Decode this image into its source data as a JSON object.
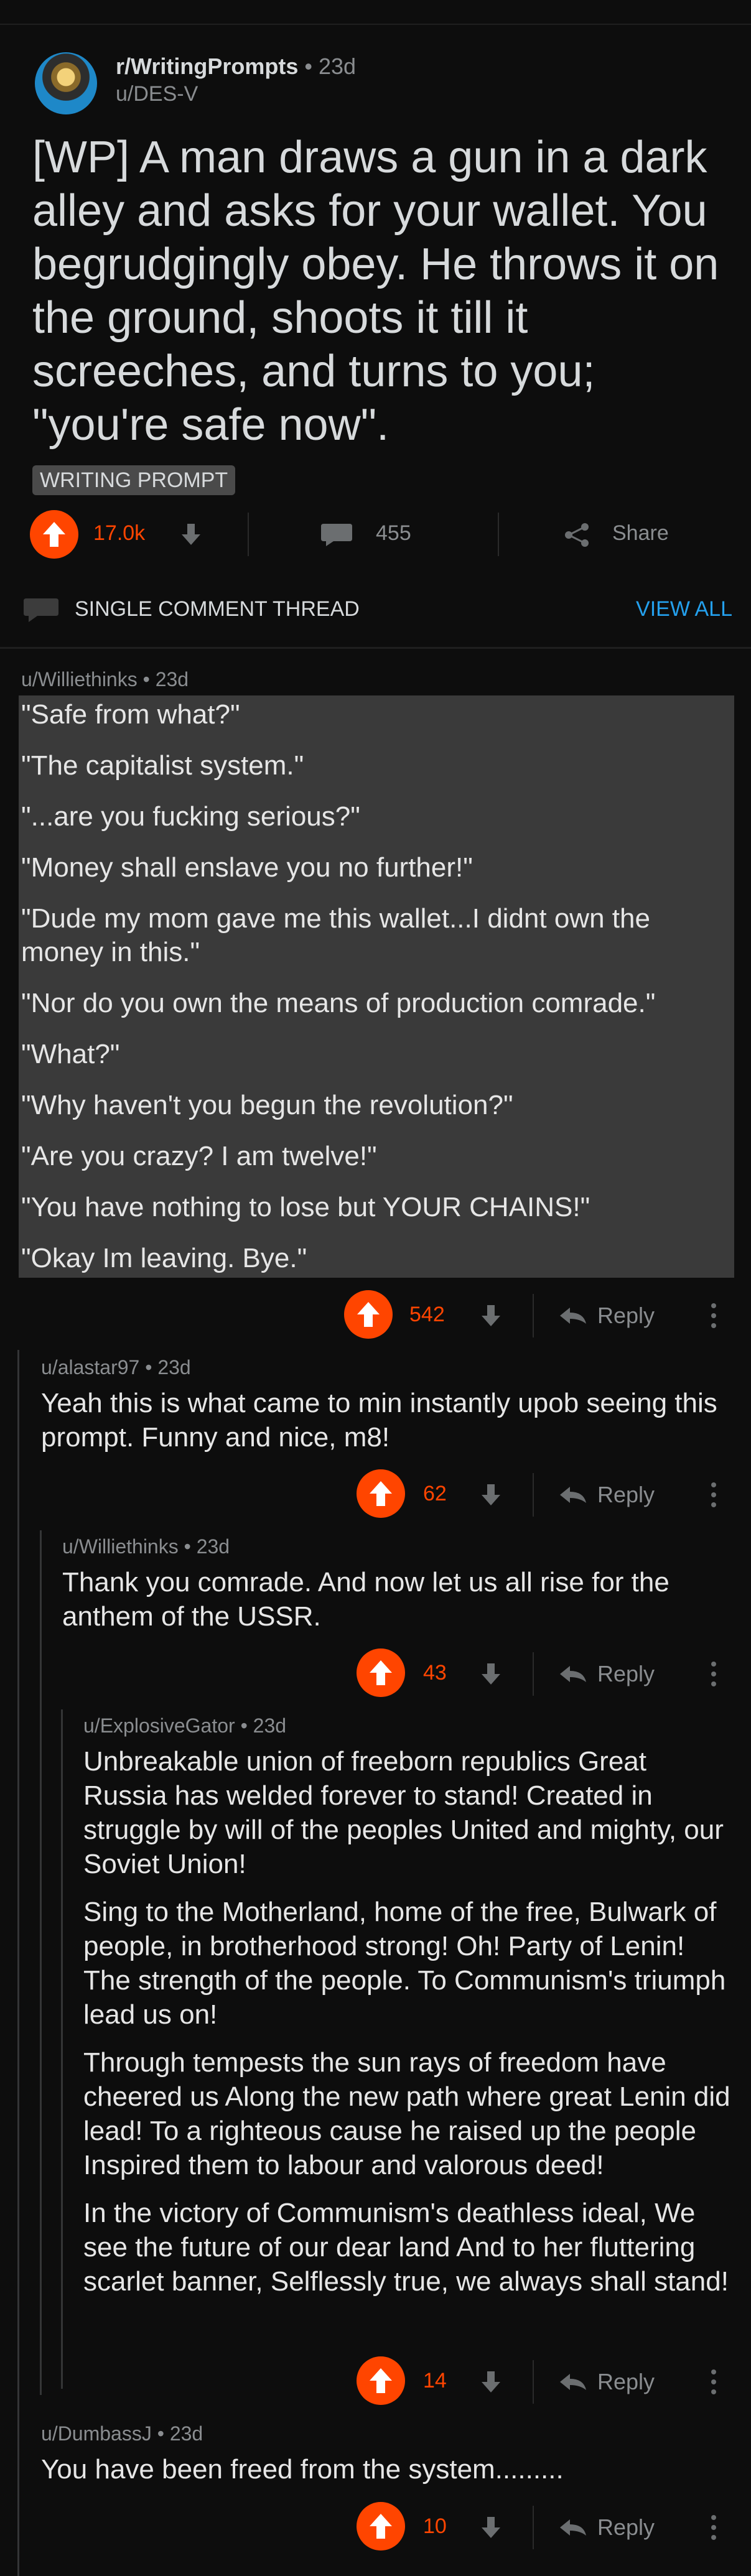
{
  "post": {
    "subreddit": "r/WritingPrompts",
    "time": " • 23d",
    "author": "u/DES-V",
    "title": "[WP] A man draws a gun in a dark alley and asks for your wallet. You begrudgingly obey. He throws it on the ground, shoots it till it screeches, and turns to you; \"you're safe now\".",
    "flair": "WRITING PROMPT",
    "votes": "17.0k",
    "comments": "455",
    "share": "Share"
  },
  "thread": {
    "label": "SINGLE COMMENT THREAD",
    "view_all": "VIEW ALL"
  },
  "comments": [
    {
      "meta": "u/Williethinks • 23d",
      "lines": [
        "\"Safe from what?\"",
        "\"The capitalist system.\"",
        "\"...are you fucking serious?\"",
        "\"Money shall enslave you no further!\"",
        "\"Dude my mom gave me this wallet...I didnt own the",
        "money in this.\"",
        "\"Nor do you own the means of production comrade.\"",
        "\"What?\"",
        "\"Why haven't you begun the revolution?\"",
        "\"Are you crazy? I am twelve!\"",
        "\"You have nothing to lose but YOUR CHAINS!\"",
        "\"Okay Im leaving. Bye.\""
      ],
      "votes": "542",
      "reply": "Reply"
    },
    {
      "meta": "u/alastar97 • 23d",
      "body": "Yeah this is what came to min instantly upob seeing this prompt. Funny and nice, m8!",
      "votes": "62",
      "reply": "Reply"
    },
    {
      "meta": "u/Williethinks • 23d",
      "body": "Thank you comrade. And now let us all rise for the anthem of the USSR.",
      "votes": "43",
      "reply": "Reply"
    },
    {
      "meta": "u/ExplosiveGator • 23d",
      "paragraphs": [
        "Unbreakable union of freeborn republics Great Russia has welded forever to stand! Created in struggle by will of the peoples United and mighty, our Soviet Union!",
        "Sing to the Motherland, home of the free, Bulwark of people, in brotherhood strong! Oh! Party of Lenin! The strength of the people. To Communism's triumph lead us on!",
        "Through tempests the sun rays of freedom have cheered us Along the new path where great Lenin did lead! To a righteous cause he raised up the people Inspired them to labour and valorous deed!",
        "In the victory of Communism's deathless ideal, We see the future of our dear land And to her fluttering scarlet banner, Selflessly true, we always shall stand!"
      ],
      "votes": "14",
      "reply": "Reply"
    },
    {
      "meta": "u/DumbassJ • 23d",
      "body": "You have been freed from the system.........",
      "votes": "10",
      "reply": "Reply"
    }
  ],
  "colors": {
    "accent": "#ff4500",
    "link": "#24a0ed",
    "background": "#0d0d0d"
  }
}
